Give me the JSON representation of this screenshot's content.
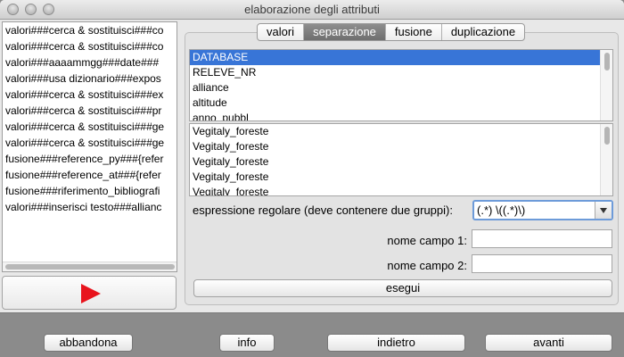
{
  "window": {
    "title": "elaborazione degli attributi"
  },
  "left_list": {
    "items": [
      "valori###cerca & sostituisci###co",
      "valori###cerca & sostituisci###co",
      "valori###aaaammgg###date###",
      "valori###usa dizionario###expos",
      "valori###cerca & sostituisci###ex",
      "valori###cerca & sostituisci###pr",
      "valori###cerca & sostituisci###ge",
      "valori###cerca & sostituisci###ge",
      "fusione###reference_py###{refer",
      "fusione###reference_at###{refer",
      "fusione###riferimento_bibliografi",
      "valori###inserisci testo###allianc"
    ]
  },
  "tabs": [
    {
      "label": "valori",
      "active": false
    },
    {
      "label": "separazione",
      "active": true
    },
    {
      "label": "fusione",
      "active": false
    },
    {
      "label": "duplicazione",
      "active": false
    }
  ],
  "fields_list": {
    "items": [
      "DATABASE",
      "RELEVE_NR",
      "alliance",
      "altitude",
      "anno_pubbl"
    ],
    "selected_index": 0
  },
  "values_list": {
    "items": [
      "Vegitaly_foreste",
      "Vegitaly_foreste",
      "Vegitaly_foreste",
      "Vegitaly_foreste",
      "Vegitaly_foreste"
    ]
  },
  "regex": {
    "label": "espressione regolare (deve contenere due gruppi):",
    "value": "(.*) \\((.*)\\)"
  },
  "field1": {
    "label": "nome campo 1:",
    "value": ""
  },
  "field2": {
    "label": "nome campo 2:",
    "value": ""
  },
  "esegui_label": "esegui",
  "bottom": {
    "abbandona": "abbandona",
    "info": "info",
    "indietro": "indietro",
    "avanti": "avanti"
  },
  "colors": {
    "selection": "#3875d7",
    "play": "#e8141d",
    "focus": "#6d9bd9"
  }
}
